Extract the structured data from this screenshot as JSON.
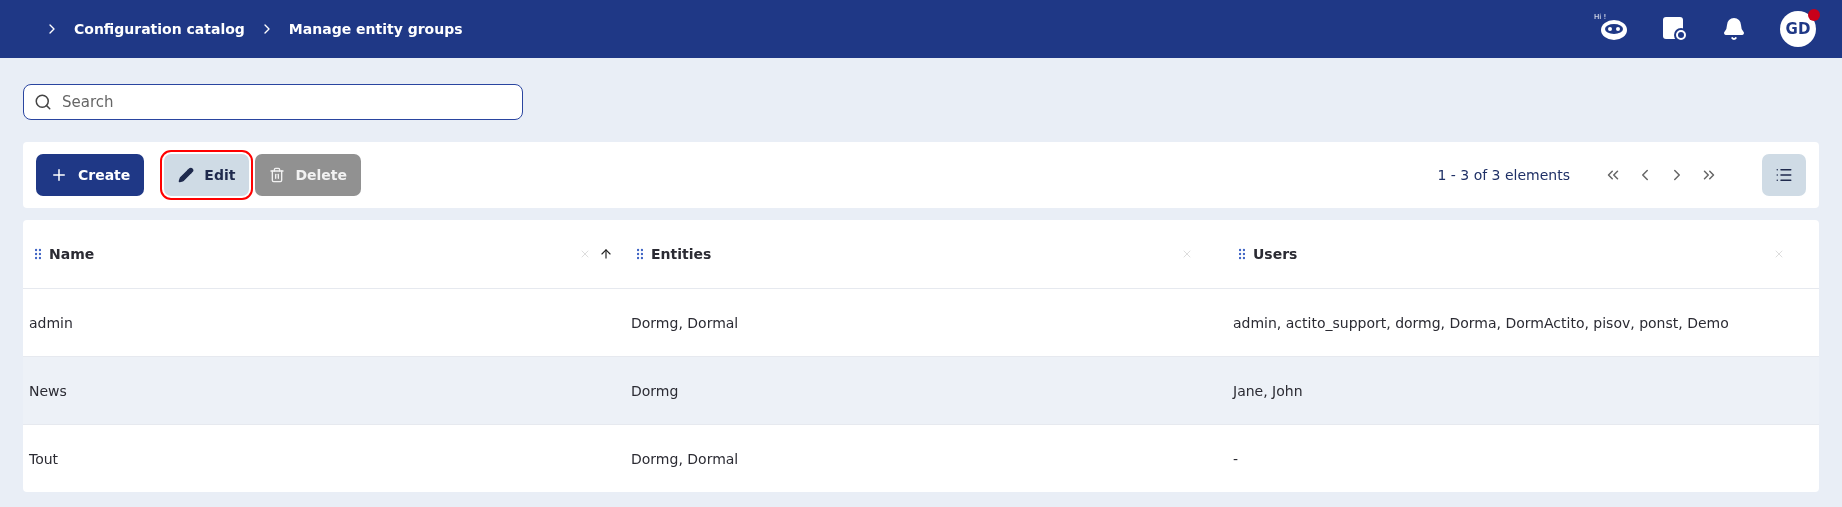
{
  "breadcrumbs": [
    {
      "label": "Configuration catalog"
    },
    {
      "label": "Manage entity groups"
    }
  ],
  "header": {
    "assistant_greeting": "Hi !",
    "avatar_initials": "GD",
    "avatar_notification": true
  },
  "search": {
    "placeholder": "Search"
  },
  "toolbar": {
    "buttons": [
      {
        "kind": "create",
        "label": "Create",
        "disabled": false,
        "highlighted": false
      },
      {
        "kind": "edit",
        "label": "Edit",
        "disabled": false,
        "highlighted": true
      },
      {
        "kind": "delete",
        "label": "Delete",
        "disabled": true,
        "highlighted": false
      }
    ],
    "pagination": "1 - 3 of 3 elements"
  },
  "table": {
    "columns": [
      {
        "label": "Name",
        "sorted": true
      },
      {
        "label": "Entities",
        "sorted": false
      },
      {
        "label": "Users",
        "sorted": false
      }
    ],
    "rows": [
      {
        "selected": false,
        "cells": [
          "admin",
          "Dormg, Dormal",
          "admin, actito_support, dormg, Dorma, DormActito, pisov, ponst, Demo"
        ]
      },
      {
        "selected": true,
        "cells": [
          "News",
          "Dormg",
          "Jane, John"
        ]
      },
      {
        "selected": false,
        "cells": [
          "Tout",
          "Dormg, Dormal",
          "-"
        ]
      }
    ]
  }
}
